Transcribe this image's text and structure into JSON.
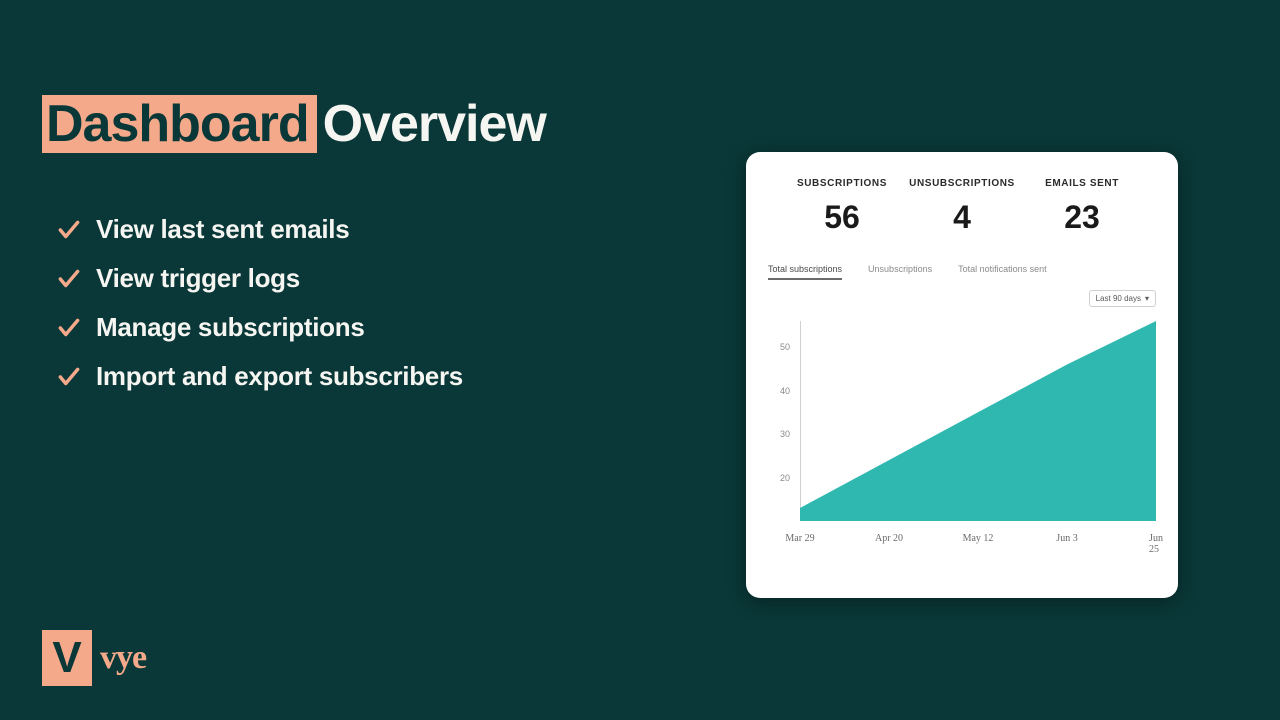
{
  "title": {
    "highlight": "Dashboard",
    "rest": "Overview"
  },
  "bullets": [
    "View last sent emails",
    "View trigger logs",
    "Manage subscriptions",
    "Import and export subscribers"
  ],
  "metrics": [
    {
      "label": "SUBSCRIPTIONS",
      "value": "56"
    },
    {
      "label": "UNSUBSCRIPTIONS",
      "value": "4"
    },
    {
      "label": "EMAILS SENT",
      "value": "23"
    }
  ],
  "tabs": [
    {
      "label": "Total subscriptions",
      "active": true
    },
    {
      "label": "Unsubscriptions",
      "active": false
    },
    {
      "label": "Total notifications sent",
      "active": false
    }
  ],
  "range": "Last 90 days",
  "logo": {
    "letter": "V",
    "name": "vye"
  },
  "colors": {
    "accent": "#f4a98a",
    "chart_fill": "#2fb8b0",
    "bg": "#0a3737"
  },
  "chart_data": {
    "type": "area",
    "title": "",
    "xlabel": "",
    "ylabel": "",
    "ylim": [
      10,
      56
    ],
    "x_ticks": [
      "Mar 29",
      "Apr 20",
      "May 12",
      "Jun 3",
      "Jun 25"
    ],
    "y_ticks": [
      20,
      30,
      40,
      50
    ],
    "x": [
      "Mar 29",
      "Apr 20",
      "May 12",
      "Jun 3",
      "Jun 25"
    ],
    "values": [
      13,
      24,
      35,
      46,
      56
    ],
    "series": [
      {
        "name": "Total subscriptions",
        "values": [
          13,
          24,
          35,
          46,
          56
        ]
      }
    ]
  }
}
